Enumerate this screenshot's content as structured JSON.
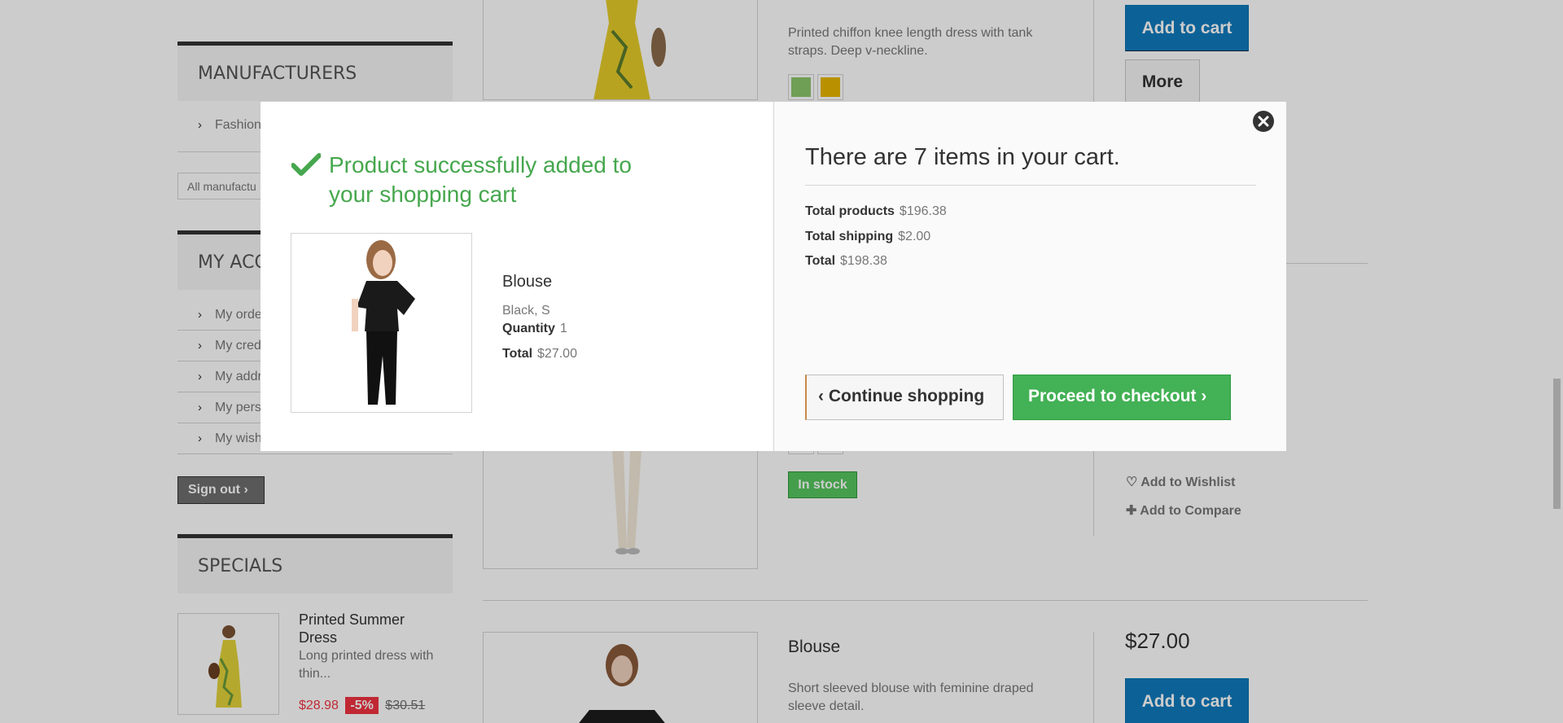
{
  "sidebar": {
    "manufacturers": {
      "title": "Manufacturers",
      "items": [
        "Fashion"
      ],
      "select_value": "All manufactu"
    },
    "account": {
      "title": "My acc",
      "items": [
        "My orde",
        "My cred",
        "My addr",
        "My pers",
        "My wish"
      ],
      "signout": "Sign out"
    },
    "specials": {
      "title": "Specials",
      "product_name": "Printed Summer Dress",
      "product_desc": "Long printed dress with thin...",
      "price_new": "$28.98",
      "discount": "-5%",
      "price_old": "$30.51"
    }
  },
  "listing": {
    "product1_desc": "Printed chiffon knee length dress with tank straps. Deep v-neckline.",
    "add_to_cart": "Add to cart",
    "more": "More",
    "in_stock": "In stock",
    "add_to_wishlist": "Add to Wishlist",
    "add_to_compare": "Add to Compare",
    "product3_name": "Blouse",
    "product3_desc": "Short sleeved blouse with feminine draped sleeve detail.",
    "product3_price": "$27.00"
  },
  "modal": {
    "success_line1": "Product successfully added to",
    "success_line2": "your shopping cart",
    "product_name": "Blouse",
    "attributes": "Black, S",
    "quantity_label": "Quantity",
    "quantity_value": "1",
    "total_label": "Total",
    "total_value": "$27.00",
    "cart_count_text": "There are 7 items in your cart.",
    "total_products_label": "Total products",
    "total_products_value": "$196.38",
    "total_shipping_label": "Total shipping",
    "total_shipping_value": "$2.00",
    "grand_total_label": "Total",
    "grand_total_value": "$198.38",
    "continue_label": "Continue shopping",
    "checkout_label": "Proceed to checkout"
  },
  "colors": {
    "success_green": "#46a74e",
    "cart_blue": "#0f7bbd",
    "sale_red": "#f13340",
    "swatch_green": "#8bc66b",
    "swatch_yellow": "#e8b600",
    "swatch_orange": "#f39c11",
    "swatch_blue": "#5d9cec"
  }
}
